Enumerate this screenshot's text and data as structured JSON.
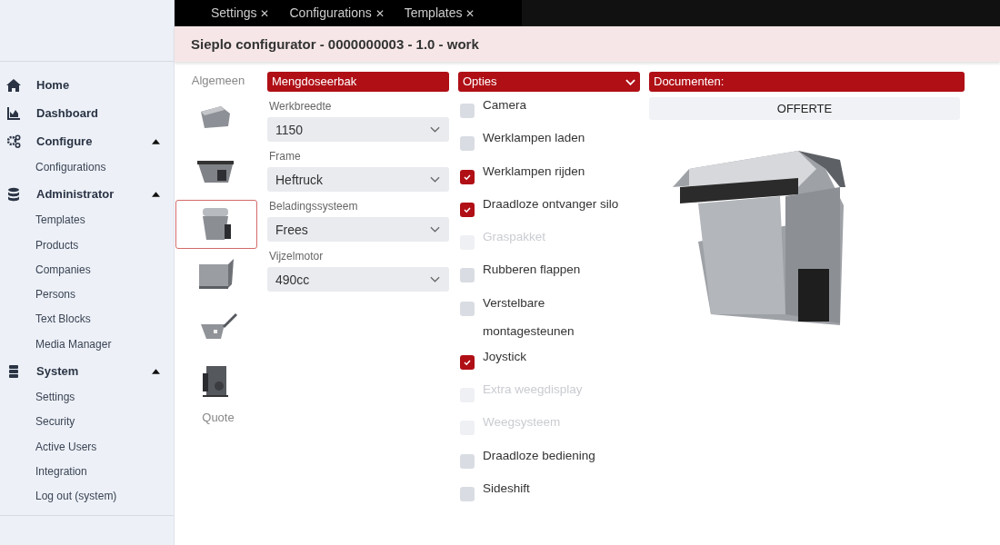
{
  "tabs": [
    {
      "label": "Settings",
      "close": "✕"
    },
    {
      "label": "Configurations",
      "close": "✕"
    },
    {
      "label": "Templates",
      "close": "✕"
    }
  ],
  "title": "Sieplo configurator - 0000000003 - 1.0 - work",
  "sidebar": {
    "groups": [
      {
        "label": "Home"
      },
      {
        "label": "Dashboard"
      },
      {
        "label": "Configure",
        "expanded": true,
        "children": [
          "Configurations"
        ]
      },
      {
        "label": "Administrator",
        "expanded": true,
        "children": [
          "Templates",
          "Products",
          "Companies",
          "Persons",
          "Text Blocks",
          "Media Manager"
        ]
      },
      {
        "label": "System",
        "expanded": true,
        "children": [
          "Settings",
          "Security",
          "Active Users",
          "Integration",
          "Log out (system)"
        ]
      }
    ]
  },
  "steps": {
    "first_label": "Algemeen",
    "last_label": "Quote",
    "thumbnails": [
      {
        "kind": "hopper",
        "selected": false
      },
      {
        "kind": "bucket",
        "selected": false
      },
      {
        "kind": "mixer",
        "selected": true
      },
      {
        "kind": "box",
        "selected": false
      },
      {
        "kind": "auger",
        "selected": false
      },
      {
        "kind": "unit",
        "selected": false
      }
    ]
  },
  "config": {
    "heading": "Mengdoseerbak",
    "fields": [
      {
        "label": "Werkbreedte",
        "value": "1150"
      },
      {
        "label": "Frame",
        "value": "Heftruck"
      },
      {
        "label": "Beladingssysteem",
        "value": "Frees"
      },
      {
        "label": "Vijzelmotor",
        "value": "490cc"
      }
    ]
  },
  "options": {
    "heading": "Opties",
    "items": [
      {
        "label": "Camera",
        "checked": false,
        "disabled": false
      },
      {
        "label": "Werklampen laden",
        "checked": false,
        "disabled": false
      },
      {
        "label": "Werklampen rijden",
        "checked": true,
        "disabled": false
      },
      {
        "label": "Draadloze ontvanger silo",
        "checked": true,
        "disabled": false
      },
      {
        "label": "Graspakket",
        "checked": false,
        "disabled": true
      },
      {
        "label": "Rubberen flappen",
        "checked": false,
        "disabled": false
      },
      {
        "label": "Verstelbare montagesteunen",
        "checked": false,
        "disabled": false
      },
      {
        "label": "Joystick",
        "checked": true,
        "disabled": false
      },
      {
        "label": "Extra weegdisplay",
        "checked": false,
        "disabled": true
      },
      {
        "label": "Weegsysteem",
        "checked": false,
        "disabled": true
      },
      {
        "label": "Draadloze bediening",
        "checked": false,
        "disabled": false
      },
      {
        "label": "Sideshift",
        "checked": false,
        "disabled": false
      }
    ]
  },
  "documents": {
    "heading": "Documenten:",
    "buttons": [
      "OFFERTE"
    ]
  }
}
